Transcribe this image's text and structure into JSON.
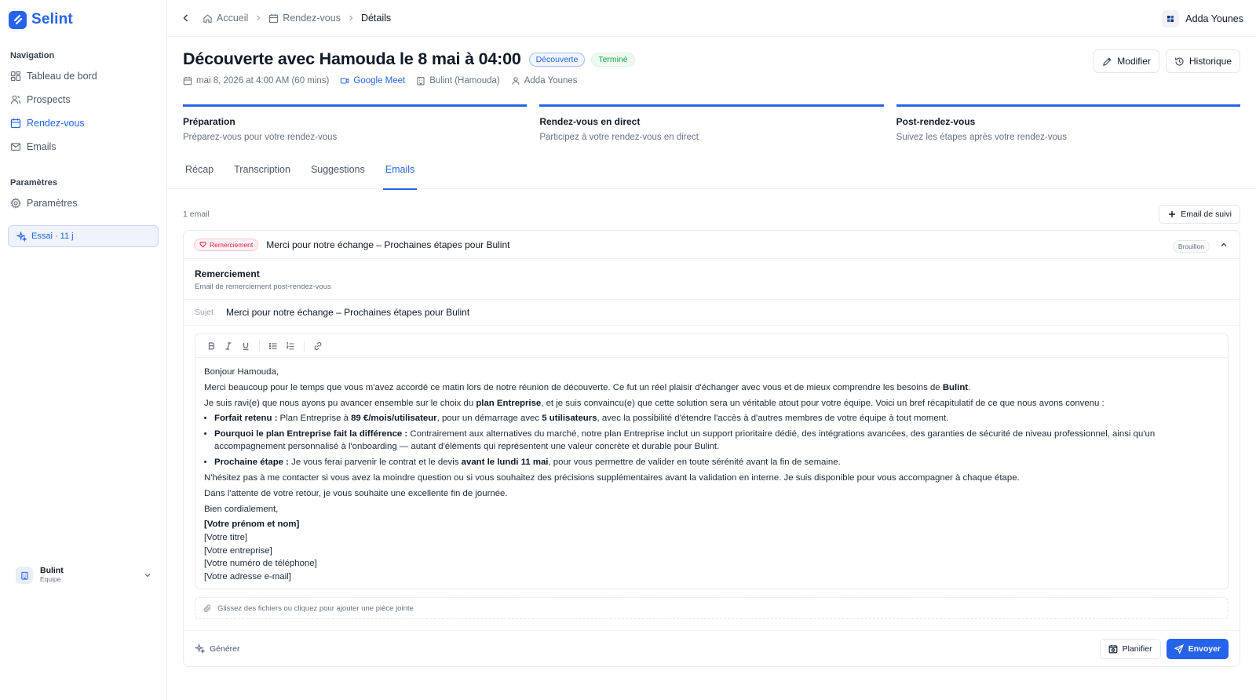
{
  "brand": {
    "name": "Selint",
    "color": "#2563eb"
  },
  "sidebar": {
    "nav_label": "Navigation",
    "nav_items": [
      {
        "label": "Tableau de bord",
        "icon": "dashboard-icon",
        "active": false
      },
      {
        "label": "Prospects",
        "icon": "users-icon",
        "active": false
      },
      {
        "label": "Rendez-vous",
        "icon": "calendar-icon",
        "active": true
      },
      {
        "label": "Emails",
        "icon": "mail-icon",
        "active": false
      }
    ],
    "settings_label": "Paramètres",
    "settings_items": [
      {
        "label": "Paramètres",
        "icon": "gear-icon"
      }
    ],
    "trial": {
      "label": "Essai · 11 j",
      "icon": "sparkles-icon"
    },
    "workspace": {
      "name": "Bulint",
      "sub": "Equipe"
    }
  },
  "topbar": {
    "breadcrumb": [
      "Accueil",
      "Rendez-vous",
      "Détails"
    ],
    "user": "Adda Younes"
  },
  "meeting": {
    "title": "Découverte avec Hamouda le 8 mai à 04:00",
    "type_badge": "Découverte",
    "status_badge": "Terminé",
    "date": "mai 8, 2026 at 4:00 AM (60 mins)",
    "platform": "Google Meet",
    "company": "Bulint (Hamouda)",
    "owner": "Adda Younes",
    "actions": {
      "edit": "Modifier",
      "history": "Historique"
    }
  },
  "steps": [
    {
      "title": "Préparation",
      "desc": "Préparez-vous pour votre rendez-vous"
    },
    {
      "title": "Rendez-vous en direct",
      "desc": "Participez à votre rendez-vous en direct"
    },
    {
      "title": "Post-rendez-vous",
      "desc": "Suivez les étapes après votre rendez-vous"
    }
  ],
  "tabs": [
    {
      "label": "Récap",
      "active": false
    },
    {
      "label": "Transcription",
      "active": false
    },
    {
      "label": "Suggestions",
      "active": false
    },
    {
      "label": "Emails",
      "active": true
    }
  ],
  "emails": {
    "count": "1 email",
    "followup_button": "Email de suivi",
    "card": {
      "tag": "Remerciement",
      "subject": "Merci pour notre échange – Prochaines étapes pour Bulint",
      "status": "Brouillon",
      "template_title": "Remerciement",
      "template_sub": "Email de remerciement post-rendez-vous",
      "subject_label": "Sujet",
      "subject_value": "Merci pour notre échange – Prochaines étapes pour Bulint",
      "attach_hint": "Glissez des fichiers ou cliquez pour ajouter une pièce jointe",
      "generate": "Générer",
      "schedule": "Planifier",
      "send": "Envoyer"
    },
    "body": {
      "greeting": "Bonjour Hamouda,",
      "p1_a": "Merci beaucoup pour le temps que vous m'avez accordé ce matin lors de notre réunion de découverte. Ce fut un réel plaisir d'échanger avec vous et de mieux comprendre les besoins de ",
      "p1_b": "Bulint",
      "p1_c": ".",
      "p2_a": "Je suis ravi(e) que nous ayons pu avancer ensemble sur le choix du ",
      "p2_b": "plan Entreprise",
      "p2_c": ", et je suis convaincu(e) que cette solution sera un véritable atout pour votre équipe. Voici un bref récapitulatif de ce que nous avons convenu :",
      "li1_label": "Forfait retenu :",
      "li1_a": " Plan Entreprise à ",
      "li1_b": "89 €/mois/utilisateur",
      "li1_c": ", pour un démarrage avec ",
      "li1_d": "5 utilisateurs",
      "li1_e": ", avec la possibilité d'étendre l'accès à d'autres membres de votre équipe à tout moment.",
      "li2_label": "Pourquoi le plan Entreprise fait la différence :",
      "li2_a": " Contrairement aux alternatives du marché, notre plan Entreprise inclut un support prioritaire dédié, des intégrations avancées, des garanties de sécurité de niveau professionnel, ainsi qu'un accompagnement personnalisé à l'onboarding — autant d'éléments qui représentent une valeur concrète et durable pour Bulint.",
      "li3_label": "Prochaine étape :",
      "li3_a": " Je vous ferai parvenir le contrat et le devis ",
      "li3_b": "avant le lundi 11 mai",
      "li3_c": ", pour vous permettre de valider en toute sérénité avant la fin de semaine.",
      "p3": "N'hésitez pas à me contacter si vous avez la moindre question ou si vous souhaitez des précisions supplémentaires avant la validation en interne. Je suis disponible pour vous accompagner à chaque étape.",
      "p4": "Dans l'attente de votre retour, je vous souhaite une excellente fin de journée.",
      "p5": "Bien cordialement,",
      "sig_name": "[Votre prénom et nom]",
      "sig_title": "[Votre titre]",
      "sig_company": "[Votre entreprise]",
      "sig_phone": "[Votre numéro de téléphone]",
      "sig_email": "[Votre adresse e-mail]"
    }
  }
}
